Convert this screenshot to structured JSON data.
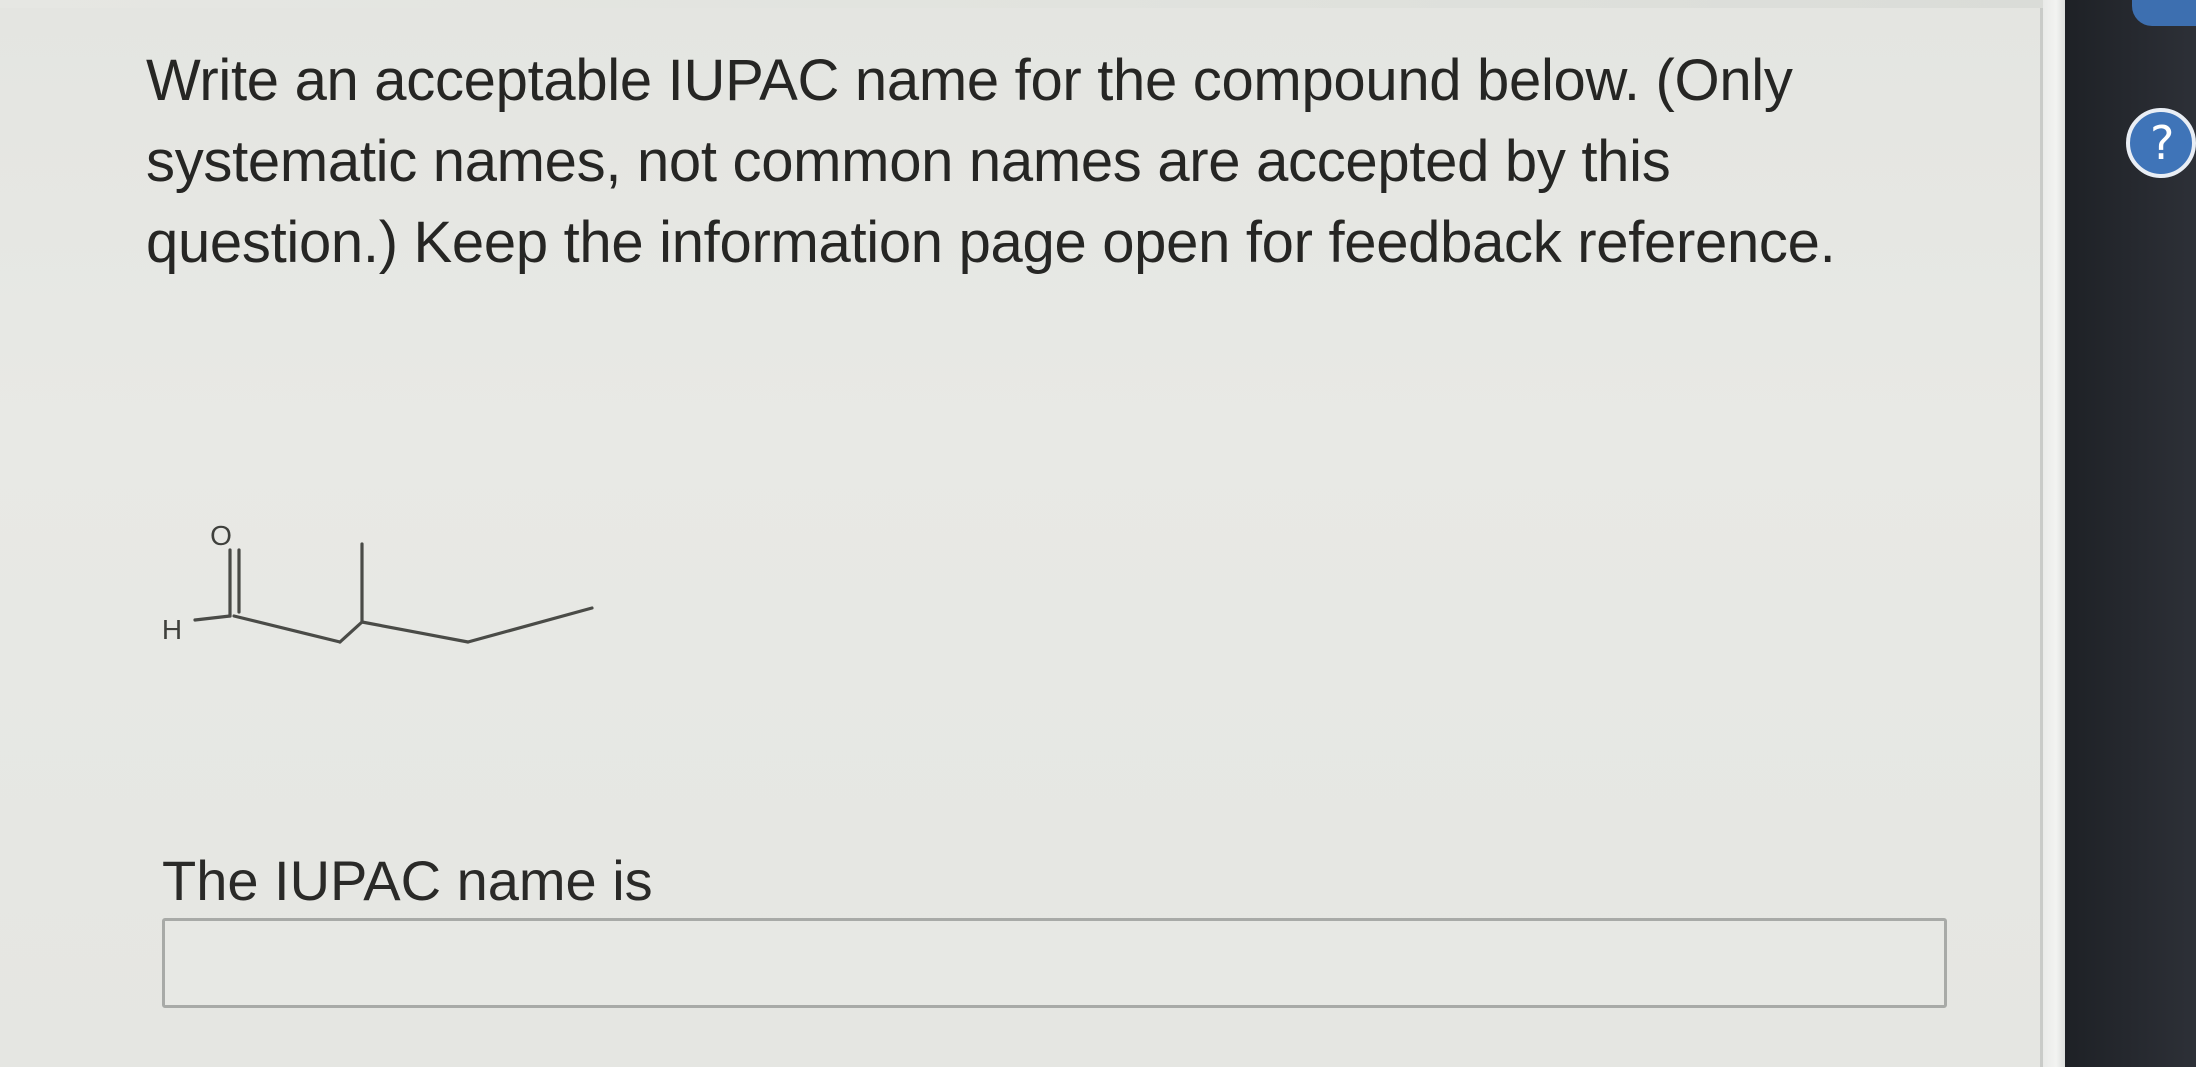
{
  "question": {
    "text": "Write an acceptable IUPAC name for the compound below. (Only systematic names, not common names are accepted by this question.) Keep the information page open for feedback reference."
  },
  "molecule": {
    "atom_labels": {
      "oxygen": "O",
      "hydrogen": "H"
    },
    "icon": "aldehyde-skeletal-structure"
  },
  "answer": {
    "label": "The IUPAC name is",
    "value": "",
    "placeholder": ""
  },
  "sidebar": {
    "help_symbol": "?",
    "help_icon": "help-icon",
    "accent_color": "#3f74b8"
  }
}
